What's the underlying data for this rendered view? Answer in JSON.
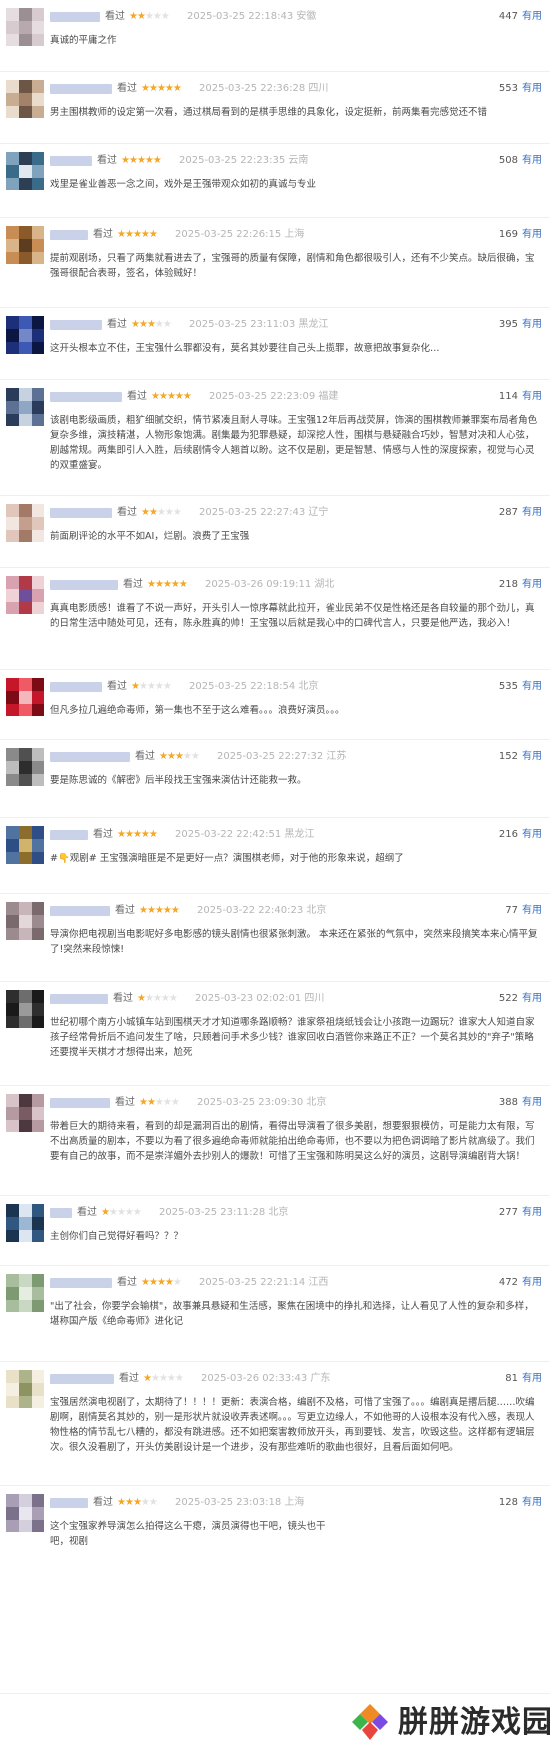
{
  "reviews": [
    {
      "watched": "看过",
      "rating": 2,
      "time": "2025-03-25 22:18:43",
      "location": "安徽",
      "useful_count": "447",
      "useful_label": "有用",
      "text": "真诚的平庸之作"
    },
    {
      "watched": "看过",
      "rating": 5,
      "time": "2025-03-25 22:36:28",
      "location": "四川",
      "useful_count": "553",
      "useful_label": "有用",
      "text": "男主围棋教师的设定第一次看，通过棋局看到的是棋手思维的具象化，设定挺新，前两集看完感觉还不错"
    },
    {
      "watched": "看过",
      "rating": 5,
      "time": "2025-03-25 22:23:35",
      "location": "云南",
      "useful_count": "508",
      "useful_label": "有用",
      "text": "戏里是雀业善恶一念之间，戏外是王强带观众如初的真诚与专业"
    },
    {
      "watched": "看过",
      "rating": 5,
      "time": "2025-03-25 22:26:15",
      "location": "上海",
      "useful_count": "169",
      "useful_label": "有用",
      "text": "提前观剧场，只看了两集就看进去了，宝强哥的质量有保障，剧情和角色都很吸引人，还有不少笑点。缺后很确，宝强哥很配合表哥，签名，体验贼好！"
    },
    {
      "watched": "看过",
      "rating": 3,
      "time": "2025-03-25 23:11:03",
      "location": "黑龙江",
      "useful_count": "395",
      "useful_label": "有用",
      "text": "这开头根本立不住，王宝强什么罪都没有，莫名其妙要往自己头上揽罪，故意把故事复杂化…"
    },
    {
      "watched": "看过",
      "rating": 5,
      "time": "2025-03-25 22:23:09",
      "location": "福建",
      "useful_count": "114",
      "useful_label": "有用",
      "text": "该剧电影级画质，粗犷细腻交织，情节紧凑且耐人寻味。王宝强12年后再战荧屏，饰演的围棋教师兼罪案布局者角色复杂多维，演技精湛，人物形象饱满。剧集最为犯罪悬疑，却深挖人性，围棋与悬疑融合巧妙，智慧对决和人心弦，剧越常规。两集即引人入胜，后续剧情令人翘首以盼。这不仅是剧，更是智慧、情感与人性的深度探索，视觉与心灵的双重盛宴。"
    },
    {
      "watched": "看过",
      "rating": 2,
      "time": "2025-03-25 22:27:43",
      "location": "辽宁",
      "useful_count": "287",
      "useful_label": "有用",
      "text": "前面刷评论的水平不如AI，烂剧。浪费了王宝强"
    },
    {
      "watched": "看过",
      "rating": 5,
      "time": "2025-03-26 09:19:11",
      "location": "湖北",
      "useful_count": "218",
      "useful_label": "有用",
      "text": "真真电影质感！谁看了不说一声好，开头引人一惊序幕就此拉开，雀业民弟不仅是性格还是各自较量的那个劲儿，真的日常生活中随处可见，还有，陈永胜真的帅！王宝强以后就是我心中的口碑代言人，只要是他严选，我必入！"
    },
    {
      "watched": "看过",
      "rating": 1,
      "time": "2025-03-25 22:18:54",
      "location": "北京",
      "useful_count": "535",
      "useful_label": "有用",
      "text": "但凡多拉几遍绝命毒师，第一集也不至于这么难看。。。浪费好演员。。。"
    },
    {
      "watched": "看过",
      "rating": 3,
      "time": "2025-03-25 22:27:32",
      "location": "江苏",
      "useful_count": "152",
      "useful_label": "有用",
      "text": "要是陈思诚的《解密》后半段找王宝强来演估计还能救一救。"
    },
    {
      "watched": "看过",
      "rating": 5,
      "time": "2025-03-22 22:42:51",
      "location": "黑龙江",
      "useful_count": "216",
      "useful_label": "有用",
      "text": "#👇观剧# 王宝强演暗匪是不是更好一点？演围棋老师，对于他的形象来说，超纲了"
    },
    {
      "watched": "看过",
      "rating": 5,
      "time": "2025-03-22 22:40:23",
      "location": "北京",
      "useful_count": "77",
      "useful_label": "有用",
      "text": "导演你把电视剧当电影呢好多电影感的镜头剧情也很紧张刺激。 本来还在紧张的气氛中，突然来段搞笑本来心情平复了!突然来段惊悚!"
    },
    {
      "watched": "看过",
      "rating": 1,
      "time": "2025-03-23 02:02:01",
      "location": "四川",
      "useful_count": "522",
      "useful_label": "有用",
      "text": "世纪初哪个南方小城镇车站到围棋天才才知道哪条路顺畅？谁家祭祖烧纸钱会让小孩跑一边踢玩？谁家大人知道自家孩子经常骨折后不追问发生了啥，只顾着问手术多少钱？谁家回收白酒管你来路正不正？一个莫名其妙的\"弃子\"策略还要搅半天棋才才想得出来，尬死"
    },
    {
      "watched": "看过",
      "rating": 2,
      "time": "2025-03-25 23:09:30",
      "location": "北京",
      "useful_count": "388",
      "useful_label": "有用",
      "text": "带着巨大的期待来看，看到的却是漏洞百出的剧情，看得出导演看了很多美剧，想要狠狠模仿，可是能力太有限，写不出高质量的剧本，不要以为看了很多遍绝命毒师就能拍出绝命毒师，也不要以为把色调调暗了影片就高级了。我们要有自己的故事，而不是崇洋媚外去抄别人的爆款！可惜了王宝强和陈明昊这么好的演员，这剧导演编剧背大锅！"
    },
    {
      "watched": "看过",
      "rating": 1,
      "time": "2025-03-25 23:11:28",
      "location": "北京",
      "useful_count": "277",
      "useful_label": "有用",
      "text": "主创你们自己觉得好看吗？？？"
    },
    {
      "watched": "看过",
      "rating": 4,
      "time": "2025-03-25 22:21:14",
      "location": "江西",
      "useful_count": "472",
      "useful_label": "有用",
      "text": "\"出了社会，你要学会输棋\"，故事兼具悬疑和生活感，聚焦在困境中的挣扎和选择，让人看见了人性的复杂和多样，堪称国产版《绝命毒师》进化记"
    },
    {
      "watched": "看过",
      "rating": 1,
      "time": "2025-03-26 02:33:43",
      "location": "广东",
      "useful_count": "81",
      "useful_label": "有用",
      "text": "宝强居然演电视剧了，太期待了！！！！更新：表演合格，编剧不及格，可惜了宝强了。。。编剧真是撂后腿……吹编剧啊，剧情莫名其妙的，别一是形状片就设收弄表述啊。。。写更立边缘人，不如他哥的人设根本没有代入感，表现人物性格的情节乱七八糟的，都没有跳进感。还不如把案害教师放开头，再到要钱、发言，吹毁这些。这样都有逻辑层次。很久没看剧了，开头仿美剧设计是一个进步，没有那些难听的歌曲也很好，且看后面如何吧。"
    },
    {
      "watched": "看过",
      "rating": 3,
      "time": "2025-03-25 23:03:18",
      "location": "上海",
      "useful_count": "128",
      "useful_label": "有用",
      "text": "这个宝强家养导演怎么拍得这么干瘪，演员演得也干吧，镜头也干吧，视剧"
    }
  ],
  "logo": {
    "text": "胼胼游戏园"
  },
  "colors": {
    "star": "#f5a623",
    "useful": "#3b73c7",
    "meta": "#b4b4b4",
    "text": "#494949",
    "logo_orange": "#f08a24",
    "logo_purple": "#7b4ae2",
    "logo_green": "#3cb54a",
    "logo_red": "#e8453c"
  },
  "icons": {
    "star_filled": "star-filled-icon",
    "star_empty": "star-empty-icon",
    "logo": "logo-icon"
  }
}
